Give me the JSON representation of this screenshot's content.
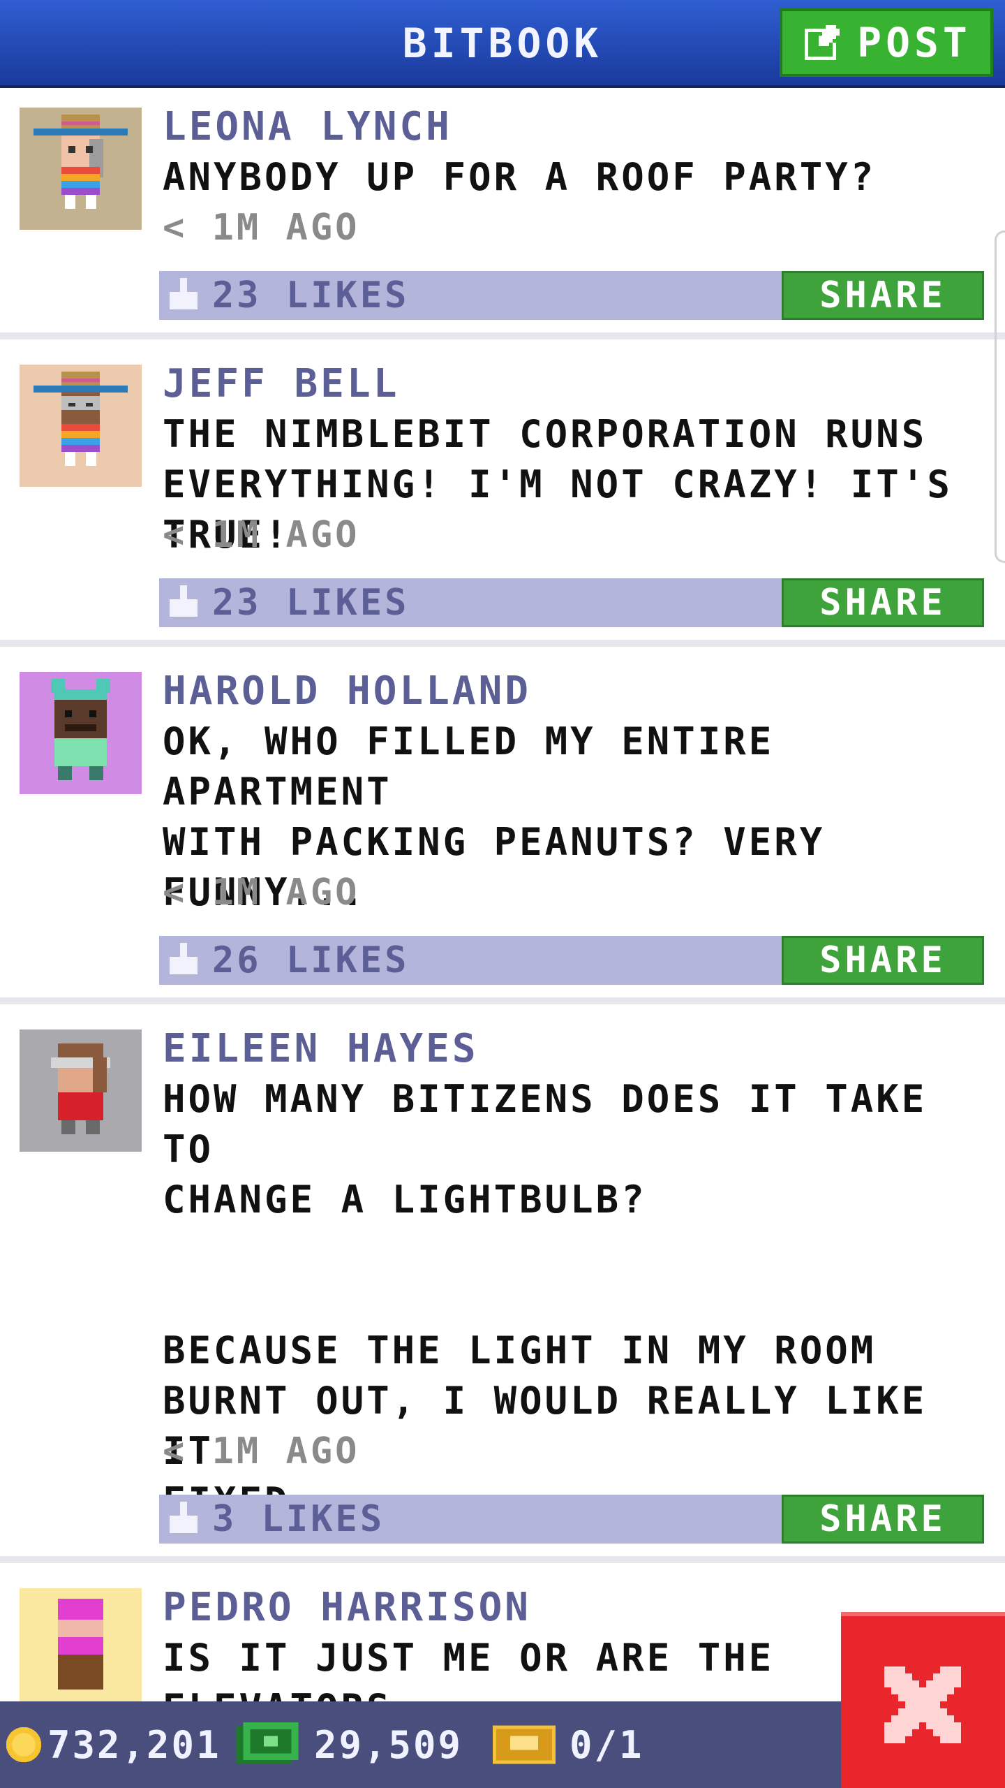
{
  "header": {
    "title": "BITBOOK",
    "post_label": "POST"
  },
  "posts": [
    {
      "author": "LEONA LYNCH",
      "message": "ANYBODY UP FOR A ROOF PARTY?",
      "time": "< 1M AGO",
      "likes": "23 LIKES",
      "share": "SHARE",
      "avatar_bg": "#c3b290"
    },
    {
      "author": "JEFF BELL",
      "message": "THE NIMBLEBIT CORPORATION RUNS\nEVERYTHING! I'M NOT CRAZY! IT'S TRUE!",
      "time": "< 1M AGO",
      "likes": "23 LIKES",
      "share": "SHARE",
      "avatar_bg": "#eccaae"
    },
    {
      "author": "HAROLD HOLLAND",
      "message": "OK, WHO FILLED MY ENTIRE APARTMENT\nWITH PACKING PEANUTS? VERY\nFUNNY...",
      "time": "< 1M AGO",
      "likes": "26 LIKES",
      "share": "SHARE",
      "avatar_bg": "#d08ce4"
    },
    {
      "author": "EILEEN HAYES",
      "message": "HOW MANY BITIZENS DOES IT TAKE TO\nCHANGE A LIGHTBULB?\n\n\nBECAUSE THE LIGHT IN MY ROOM\nBURNT OUT, I WOULD REALLY LIKE IT\nFIXED.",
      "time": "< 1M AGO",
      "likes": "3 LIKES",
      "share": "SHARE",
      "avatar_bg": "#a9a9ae"
    },
    {
      "author": "PEDRO HARRISON",
      "message": "IS IT JUST ME OR ARE THE ELEVATORS\nGETTING FASTER?",
      "avatar_bg": "#fbe8a0"
    }
  ],
  "status": {
    "coins": "732,201",
    "bux": "29,509",
    "tickets": "0/1"
  },
  "icons": {
    "post": "edit-icon",
    "like": "thumbs-up-icon",
    "coin": "coin-icon",
    "bux": "bux-icon",
    "ticket": "ticket-icon",
    "close": "close-icon"
  },
  "colors": {
    "header": "#2a52c4",
    "share": "#3ea33a",
    "like_bar": "#b3b6da",
    "author": "#5c5e96",
    "close": "#e8262b",
    "status_bar": "#4a4e7c"
  }
}
